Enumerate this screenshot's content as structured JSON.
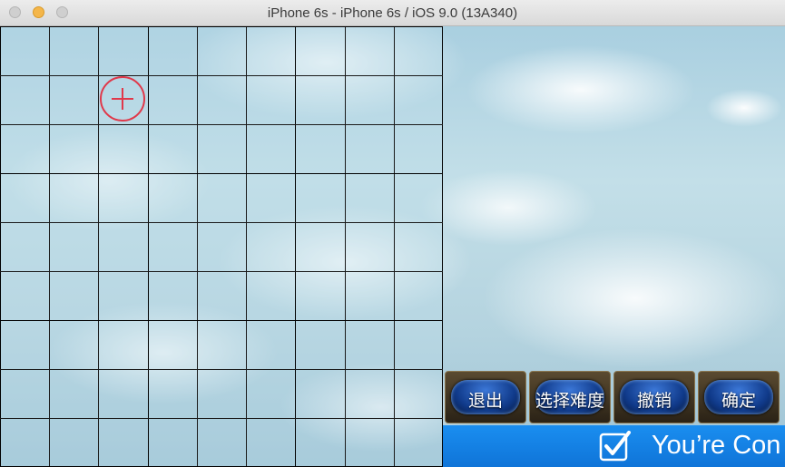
{
  "window": {
    "title": "iPhone 6s - iPhone 6s / iOS 9.0 (13A340)"
  },
  "board": {
    "columns": 9,
    "rows": 9,
    "cursor_icon": "crosshair-icon",
    "cursor_color": "#e0384a",
    "cursor_cell": {
      "column": 3,
      "row": 2
    }
  },
  "buttons": {
    "exit_label": "退出",
    "difficulty_label": "选择难度",
    "undo_label": "撤销",
    "confirm_label": "确定"
  },
  "banner": {
    "text": "You’re Con",
    "icon": "checkmark-icon",
    "color": "#1a8ef0"
  }
}
